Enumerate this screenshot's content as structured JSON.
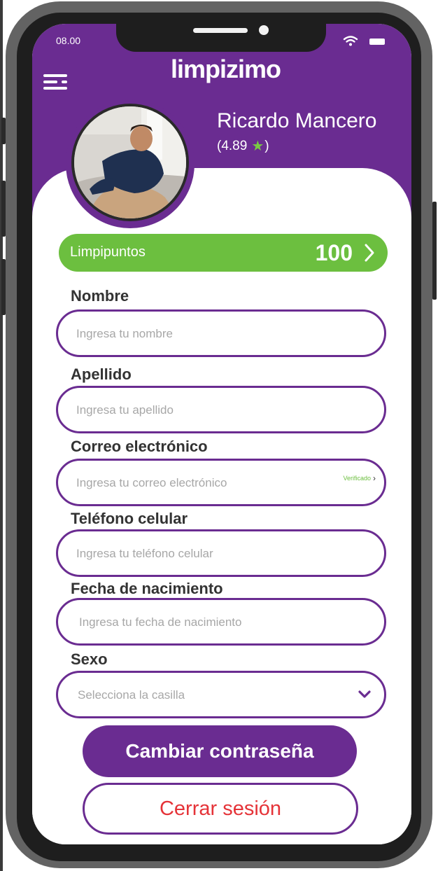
{
  "status_bar": {
    "time": "08.00",
    "wifi_icon": "wifi-icon",
    "battery_icon": "battery-icon"
  },
  "header": {
    "logo": "limpizimo",
    "menu_icon": "menu-icon"
  },
  "profile": {
    "name": "Ricardo Mancero",
    "rating_prefix": "(4.89",
    "rating_suffix": ")",
    "star_icon": "star-icon"
  },
  "points": {
    "label": "Limpipuntos",
    "value": "100",
    "chevron_icon": "chevron-right-icon"
  },
  "form": {
    "nombre": {
      "label": "Nombre",
      "placeholder": "Ingresa tu nombre"
    },
    "apellido": {
      "label": "Apellido",
      "placeholder": "Ingresa tu apellido"
    },
    "correo": {
      "label": "Correo electrónico",
      "placeholder": "Ingresa tu correo electrónico",
      "verified": "Verificado",
      "verified_chevron": "›"
    },
    "telefono": {
      "label": "Teléfono celular",
      "placeholder": "Ingresa tu teléfono celular"
    },
    "fecha": {
      "label": "Fecha de nacimiento",
      "placeholder": "Ingresa tu fecha de nacimiento"
    },
    "sexo": {
      "label": "Sexo",
      "placeholder": "Selecciona la casilla",
      "chevron_icon": "chevron-down-icon"
    }
  },
  "actions": {
    "change_password": "Cambiar contraseña",
    "logout": "Cerrar sesión"
  },
  "colors": {
    "brand_purple": "#6a2c91",
    "points_green": "#6cbf3f",
    "logout_red": "#e53338"
  }
}
